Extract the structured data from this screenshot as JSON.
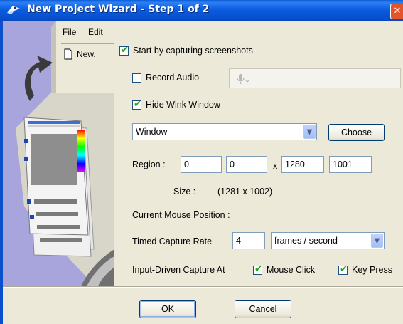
{
  "window": {
    "title": "New Project Wizard - Step 1 of 2",
    "close_glyph": "✕"
  },
  "illustration": {
    "menu_file": "File",
    "menu_edit": "Edit",
    "new_label": "New."
  },
  "options": {
    "start_capture": {
      "label": "Start by capturing screenshots",
      "checked": true
    },
    "record_audio": {
      "label": "Record Audio",
      "checked": false
    },
    "hide_wink": {
      "label": "Hide Wink Window",
      "checked": true
    }
  },
  "capture_source": {
    "selected": "Window",
    "choose_label": "Choose"
  },
  "region": {
    "label": "Region :",
    "x": "0",
    "y": "0",
    "separator": "x",
    "width": "1280",
    "height": "1001"
  },
  "size": {
    "label": "Size :",
    "value": "(1281 x 1002)"
  },
  "mouse_position": {
    "label": "Current Mouse Position :"
  },
  "timed_capture": {
    "label": "Timed Capture Rate",
    "value": "4",
    "unit": "frames / second"
  },
  "input_driven": {
    "label": "Input-Driven Capture At",
    "mouse_click": {
      "label": "Mouse Click",
      "checked": true
    },
    "key_press": {
      "label": "Key Press",
      "checked": true
    }
  },
  "buttons": {
    "ok": "OK",
    "cancel": "Cancel"
  },
  "colors": {
    "titlebar": "#0a5ce0",
    "dialog_bg": "#ece9d8",
    "art_bg": "#a8a5dc",
    "checkmark": "#21a121"
  }
}
